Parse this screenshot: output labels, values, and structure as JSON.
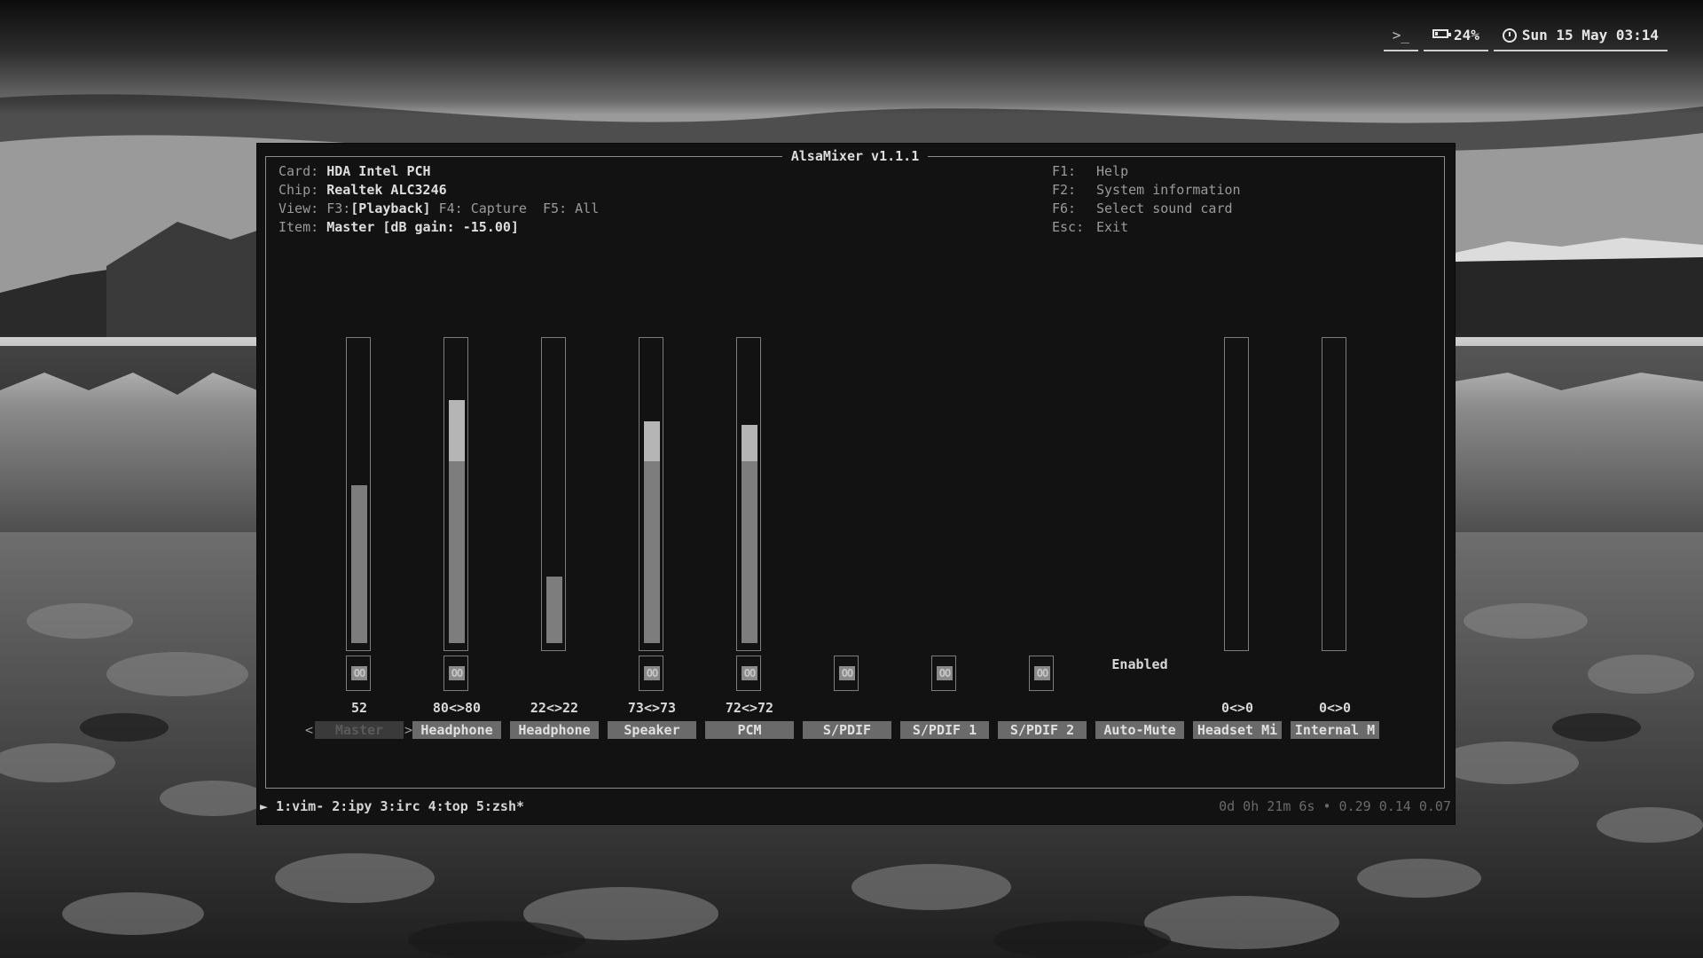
{
  "statusbar": {
    "terminal_icon": "terminal-icon",
    "terminal_glyph": ">_",
    "battery": "24%",
    "clock": "Sun 15 May 03:14"
  },
  "window": {
    "title": "AlsaMixer v1.1.1",
    "card_label": "Card:",
    "card_value": "HDA Intel PCH",
    "chip_label": "Chip:",
    "chip_value": "Realtek ALC3246",
    "view_label": "View:",
    "view_f3": "F3:",
    "view_playback": "[Playback]",
    "view_rest": " F4: Capture  F5: All",
    "item_label": "Item:",
    "item_value": "Master [dB gain: -15.00]",
    "help_keys": [
      {
        "key": "F1:",
        "text": "Help"
      },
      {
        "key": "F2:",
        "text": "System information"
      },
      {
        "key": "F6:",
        "text": "Select sound card"
      },
      {
        "key": "Esc:",
        "text": "Exit"
      }
    ]
  },
  "channels": [
    {
      "label": "Master",
      "value": "52",
      "level": 52,
      "has_bar": true,
      "mute": "OO",
      "selected": true
    },
    {
      "label": "Headphone",
      "value": "80<>80",
      "level": 80,
      "has_bar": true,
      "mute": "OO"
    },
    {
      "label": "Headphone",
      "value": "22<>22",
      "level": 22,
      "has_bar": true
    },
    {
      "label": "Speaker",
      "value": "73<>73",
      "level": 73,
      "has_bar": true,
      "mute": "OO"
    },
    {
      "label": "PCM",
      "value": "72<>72",
      "level": 72,
      "has_bar": true,
      "mute": "OO"
    },
    {
      "label": "S/PDIF",
      "value": "",
      "has_bar": false,
      "mute": "OO"
    },
    {
      "label": "S/PDIF 1",
      "value": "",
      "has_bar": false,
      "mute": "OO"
    },
    {
      "label": "S/PDIF 2",
      "value": "",
      "has_bar": false,
      "mute": "OO"
    },
    {
      "label": "Auto-Mute",
      "value": "",
      "has_bar": false,
      "enum": "Enabled"
    },
    {
      "label": "Headset Mi",
      "value": "0<>0",
      "level": 0,
      "has_bar": true
    },
    {
      "label": "Internal M",
      "value": "0<>0",
      "level": 0,
      "has_bar": true
    }
  ],
  "nav": {
    "left": "<",
    "right": ">"
  },
  "tmux": {
    "windows": "► 1:vim- 2:ipy 3:irc 4:top 5:zsh*",
    "status": "0d 0h 21m 6s • 0.29 0.14 0.07"
  },
  "colors": {
    "bar_fill": "#7d7d7d",
    "bar_highlight": "#b5b5b5",
    "label_bg": "#6a6a6a"
  }
}
